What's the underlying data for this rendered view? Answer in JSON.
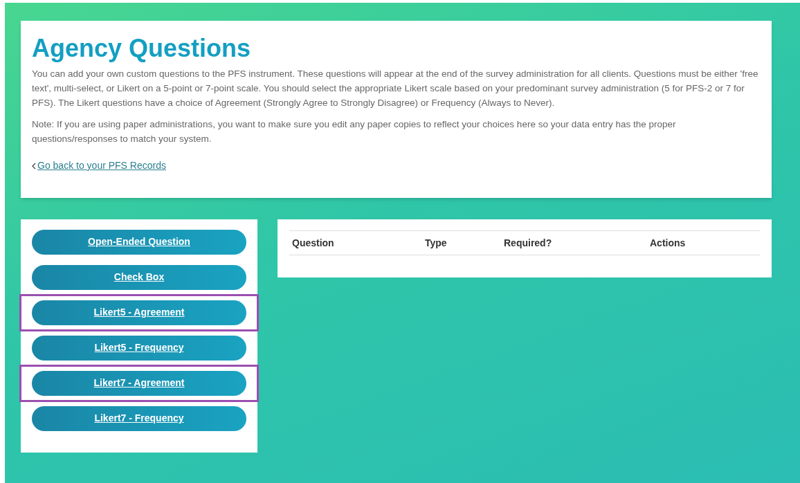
{
  "header": {
    "title": "Agency Questions",
    "paragraphs": [
      "You can add your own custom questions to the PFS instrument. These questions will appear at the end of the survey administration for all clients. Questions must be either 'free text', multi-select, or Likert on a 5-point or 7-point scale. You should select the appropriate Likert scale based on your predominant survey administration (5 for PFS-2 or 7 for PFS). The Likert questions have a choice of Agreement (Strongly Agree to Strongly Disagree) or Frequency (Always to Never).",
      "Note: If you are using paper administrations, you want to make sure you edit any paper copies to reflect your choices here so your data entry has the proper questions/responses to match your system."
    ],
    "back_link": "Go back to your PFS Records"
  },
  "question_types": [
    {
      "label": "Open-Ended Question",
      "highlighted": false
    },
    {
      "label": "Check Box",
      "highlighted": false
    },
    {
      "label": "Likert5 - Agreement",
      "highlighted": true
    },
    {
      "label": "Likert5 - Frequency",
      "highlighted": false
    },
    {
      "label": "Likert7 - Agreement",
      "highlighted": true
    },
    {
      "label": "Likert7 - Frequency",
      "highlighted": false
    }
  ],
  "table": {
    "columns": [
      "Question",
      "Type",
      "Required?",
      "Actions"
    ]
  }
}
